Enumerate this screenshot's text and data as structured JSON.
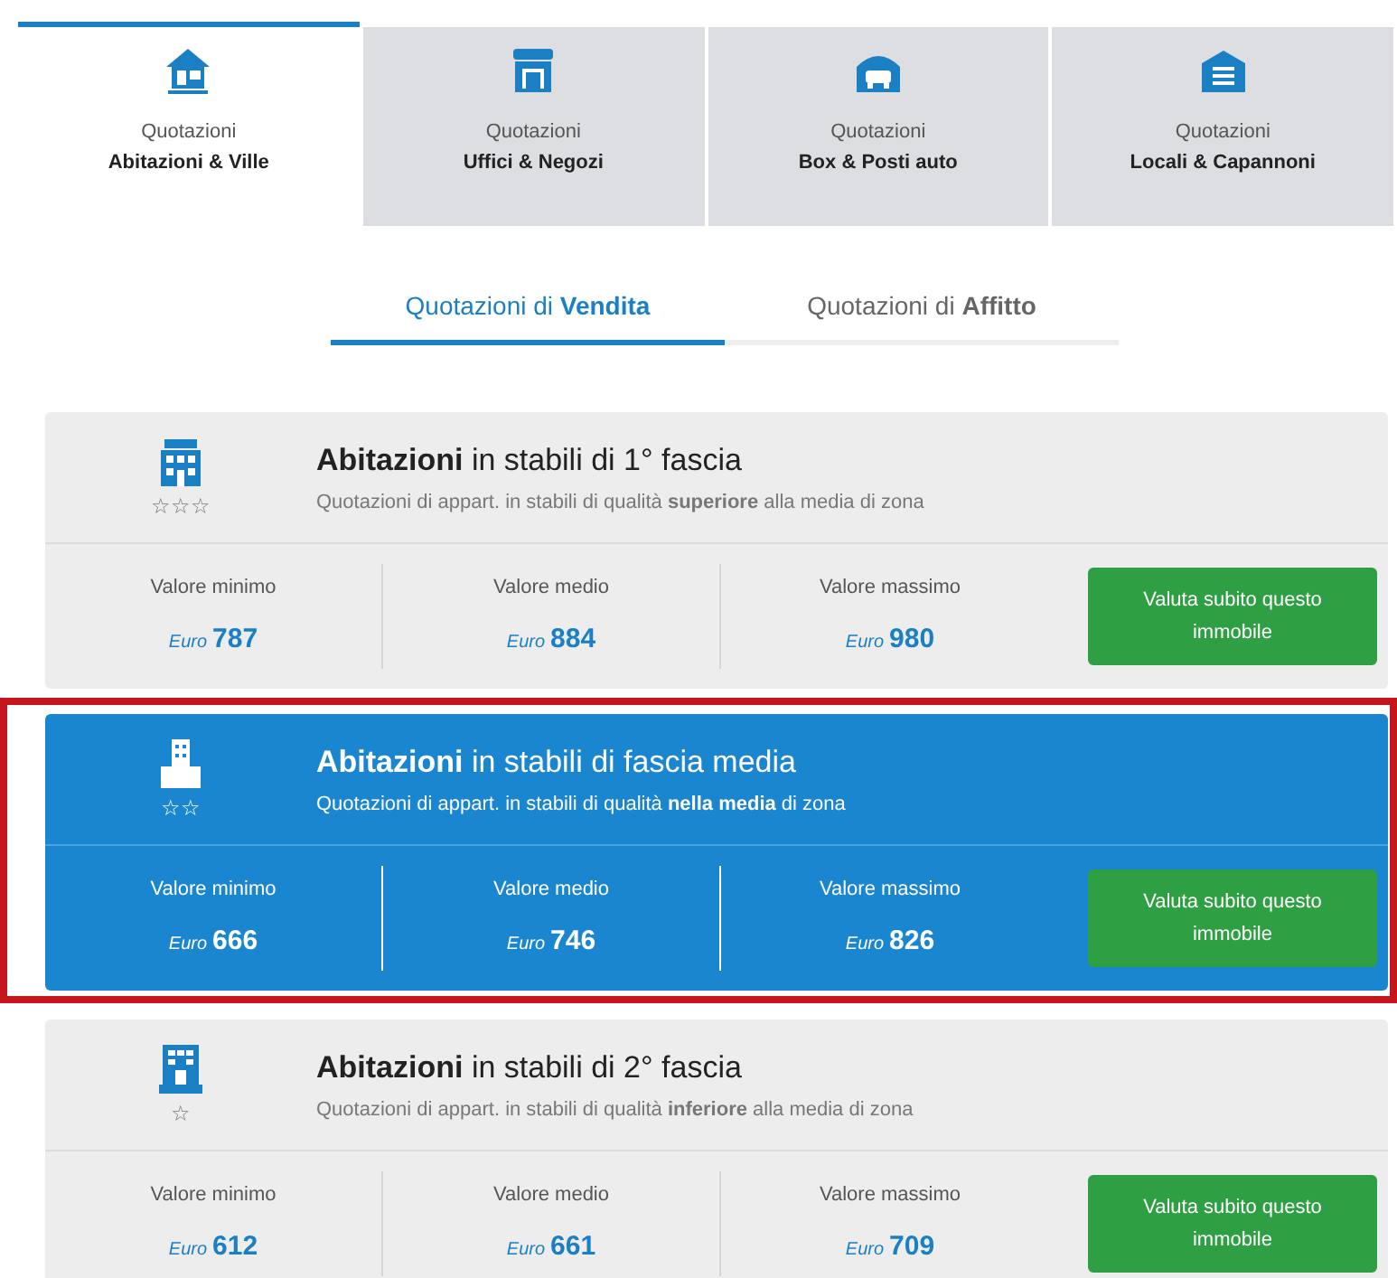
{
  "category_tabs": [
    {
      "line1": "Quotazioni",
      "line2": "Abitazioni & Ville",
      "selected": true
    },
    {
      "line1": "Quotazioni",
      "line2": "Uffici & Negozi",
      "selected": false
    },
    {
      "line1": "Quotazioni",
      "line2": "Box & Posti auto",
      "selected": false
    },
    {
      "line1": "Quotazioni",
      "line2": "Locali & Capannoni",
      "selected": false
    }
  ],
  "mode_tabs": [
    {
      "label": "Quotazioni di **Vendita**",
      "selected": true
    },
    {
      "label": "Quotazioni di **Affitto**",
      "selected": false
    }
  ],
  "cards": [
    {
      "title": "**Abitazioni** in stabili di 1° fascia",
      "subtitle": "Quotazioni di appart. in stabili di qualità **superiore** alla media di zona",
      "stars_text": "☆☆☆",
      "highlighted": false,
      "values": [
        {
          "label": "Valore minimo",
          "currency": "Euro",
          "amount": "787"
        },
        {
          "label": "Valore medio",
          "currency": "Euro",
          "amount": "884"
        },
        {
          "label": "Valore massimo",
          "currency": "Euro",
          "amount": "980"
        }
      ],
      "button": "Valuta subito questo immobile"
    },
    {
      "title": "**Abitazioni** in stabili di fascia media",
      "subtitle": "Quotazioni di appart. in stabili di qualità **nella media** di zona",
      "stars_text": "☆☆",
      "highlighted": true,
      "values": [
        {
          "label": "Valore minimo",
          "currency": "Euro",
          "amount": "666"
        },
        {
          "label": "Valore medio",
          "currency": "Euro",
          "amount": "746"
        },
        {
          "label": "Valore massimo",
          "currency": "Euro",
          "amount": "826"
        }
      ],
      "button": "Valuta subito questo immobile"
    },
    {
      "title": "**Abitazioni** in stabili di 2° fascia",
      "subtitle": "Quotazioni di appart. in stabili di qualità **inferiore** alla media di zona",
      "stars_text": "☆",
      "highlighted": false,
      "values": [
        {
          "label": "Valore minimo",
          "currency": "Euro",
          "amount": "612"
        },
        {
          "label": "Valore medio",
          "currency": "Euro",
          "amount": "661"
        },
        {
          "label": "Valore massimo",
          "currency": "Euro",
          "amount": "709"
        }
      ],
      "button": "Valuta subito questo immobile"
    }
  ]
}
